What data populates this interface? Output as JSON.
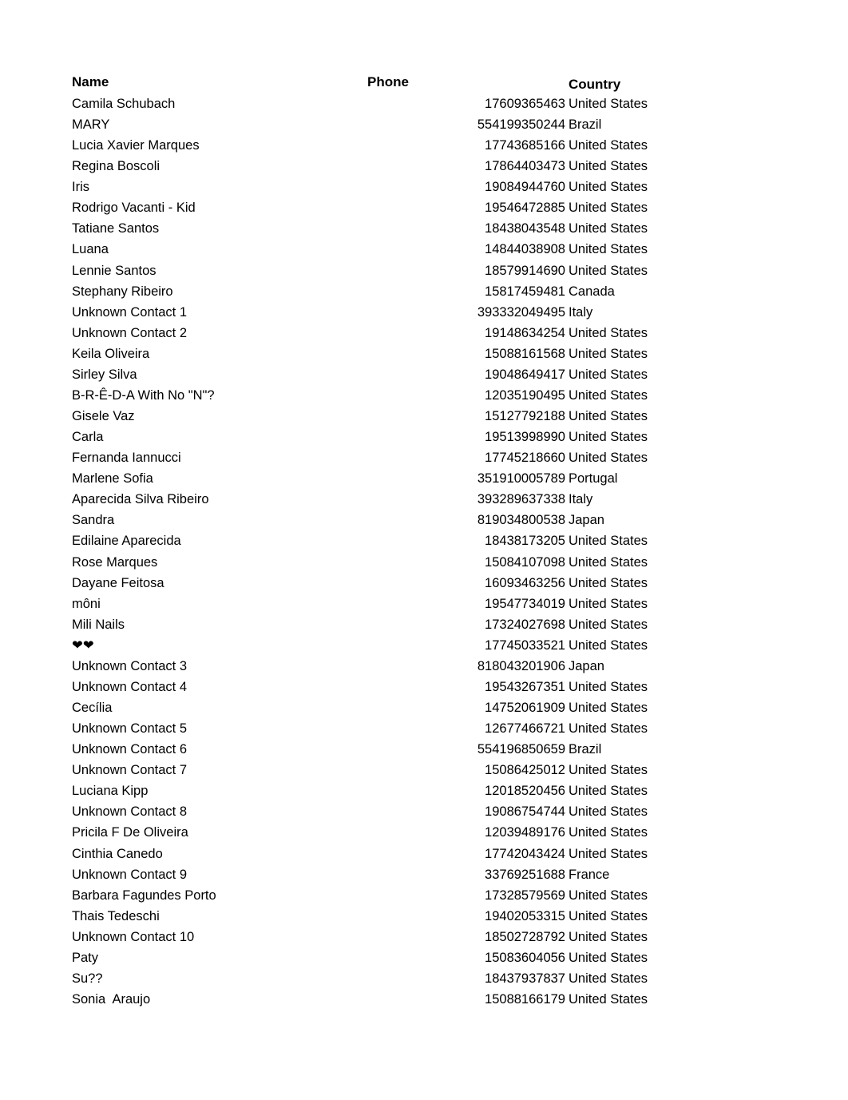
{
  "headers": {
    "name": "Name",
    "phone": "Phone",
    "country": "Country"
  },
  "rows": [
    {
      "name": "Camila Schubach",
      "phone": "17609365463",
      "country": "United States"
    },
    {
      "name": "MARY",
      "phone": "554199350244",
      "country": "Brazil"
    },
    {
      "name": "Lucia Xavier Marques",
      "phone": "17743685166",
      "country": "United States"
    },
    {
      "name": "Regina Boscoli",
      "phone": "17864403473",
      "country": "United States"
    },
    {
      "name": "Iris",
      "phone": "19084944760",
      "country": "United States"
    },
    {
      "name": "Rodrigo Vacanti - Kid",
      "phone": "19546472885",
      "country": "United States"
    },
    {
      "name": "Tatiane Santos",
      "phone": "18438043548",
      "country": "United States"
    },
    {
      "name": "Luana",
      "phone": "14844038908",
      "country": "United States"
    },
    {
      "name": "Lennie Santos",
      "phone": "18579914690",
      "country": "United States"
    },
    {
      "name": "Stephany Ribeiro",
      "phone": "15817459481",
      "country": "Canada"
    },
    {
      "name": "Unknown Contact 1",
      "phone": "393332049495",
      "country": "Italy"
    },
    {
      "name": "Unknown Contact 2",
      "phone": "19148634254",
      "country": "United States"
    },
    {
      "name": "Keila Oliveira",
      "phone": "15088161568",
      "country": "United States"
    },
    {
      "name": "Sirley Silva",
      "phone": "19048649417",
      "country": "United States"
    },
    {
      "name": "B-R-Ê-D-A With No \"N\"?",
      "phone": "12035190495",
      "country": "United States"
    },
    {
      "name": "Gisele Vaz",
      "phone": "15127792188",
      "country": "United States"
    },
    {
      "name": "Carla",
      "phone": "19513998990",
      "country": "United States"
    },
    {
      "name": "Fernanda Iannucci",
      "phone": "17745218660",
      "country": "United States"
    },
    {
      "name": "Marlene Sofia",
      "phone": "351910005789",
      "country": "Portugal"
    },
    {
      "name": "Aparecida Silva Ribeiro",
      "phone": "393289637338",
      "country": "Italy"
    },
    {
      "name": "Sandra",
      "phone": "819034800538",
      "country": "Japan"
    },
    {
      "name": "Edilaine Aparecida",
      "phone": "18438173205",
      "country": "United States"
    },
    {
      "name": "Rose Marques",
      "phone": "15084107098",
      "country": "United States"
    },
    {
      "name": "Dayane Feitosa",
      "phone": "16093463256",
      "country": "United States"
    },
    {
      "name": "môni",
      "phone": "19547734019",
      "country": "United States"
    },
    {
      "name": "Mili Nails",
      "phone": "17324027698",
      "country": "United States"
    },
    {
      "name": "❤❤",
      "phone": "17745033521",
      "country": "United States"
    },
    {
      "name": "Unknown Contact 3",
      "phone": "818043201906",
      "country": "Japan"
    },
    {
      "name": "Unknown Contact 4",
      "phone": "19543267351",
      "country": "United States"
    },
    {
      "name": "Cecília",
      "phone": "14752061909",
      "country": "United States"
    },
    {
      "name": "Unknown Contact 5",
      "phone": "12677466721",
      "country": "United States"
    },
    {
      "name": "Unknown Contact 6",
      "phone": "554196850659",
      "country": "Brazil"
    },
    {
      "name": "Unknown Contact 7",
      "phone": "15086425012",
      "country": "United States"
    },
    {
      "name": "Luciana Kipp",
      "phone": "12018520456",
      "country": "United States"
    },
    {
      "name": "Unknown Contact 8",
      "phone": "19086754744",
      "country": "United States"
    },
    {
      "name": "Pricila F De Oliveira",
      "phone": "12039489176",
      "country": "United States"
    },
    {
      "name": "Cinthia Canedo",
      "phone": "17742043424",
      "country": "United States"
    },
    {
      "name": "Unknown Contact 9",
      "phone": "33769251688",
      "country": "France"
    },
    {
      "name": "Barbara Fagundes Porto",
      "phone": "17328579569",
      "country": "United States"
    },
    {
      "name": "Thais Tedeschi",
      "phone": "19402053315",
      "country": "United States"
    },
    {
      "name": "Unknown Contact 10",
      "phone": "18502728792",
      "country": "United States"
    },
    {
      "name": "Paty",
      "phone": "15083604056",
      "country": "United States"
    },
    {
      "name": "Su??",
      "phone": "18437937837",
      "country": "United States"
    },
    {
      "name": "Sonia  Araujo",
      "phone": "15088166179",
      "country": "United States"
    }
  ]
}
